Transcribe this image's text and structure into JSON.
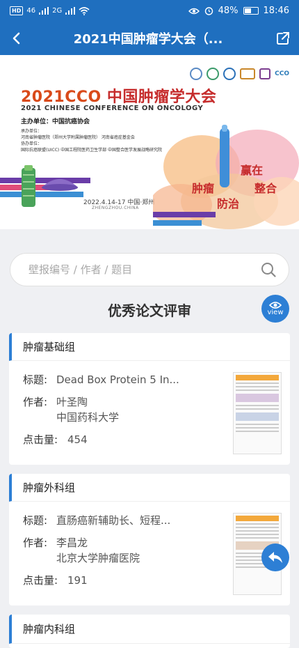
{
  "status_bar": {
    "network_badge": "HD",
    "signal_1": "46",
    "signal_2": "2G",
    "battery": "48%",
    "time": "18:46"
  },
  "nav": {
    "title": "2021中国肿瘤学大会（...",
    "back_icon": "back-arrow",
    "share_icon": "share"
  },
  "banner": {
    "title_year": "2021CCO",
    "title_cn": " 中国肿瘤学大会",
    "title_en": "2021 CHINESE CONFERENCE ON ONCOLOGY",
    "host": "主办单位：中国抗癌协会",
    "organizer_label": "承办单位：",
    "organizer_text": "河南省肿瘤医院（郑州大学附属肿瘤医院） 河南省癌症基金会",
    "co_label": "协办单位：",
    "co_text": "国际抗癌联盟(UICC) 中国工程院医药卫生学部  中国整合医学发展战略研究院",
    "date": "2022.4.14-17  中国·郑州",
    "city_en": "ZHENGZHOU.CHINA",
    "logo_text": "CCO",
    "slogan_1": "赢在",
    "slogan_2": "肿瘤",
    "slogan_3": "整合",
    "slogan_4": "防治"
  },
  "search": {
    "placeholder": "壁报编号 / 作者 / 题目"
  },
  "section": {
    "title": "优秀论文评审",
    "view_label": "view"
  },
  "cards": [
    {
      "category": "肿瘤基础组",
      "title_key": "标题:",
      "title": "Dead Box Protein 5 In...",
      "author_key": "作者:",
      "author": "叶圣陶",
      "institution": "中国药科大学",
      "clicks_key": "点击量:",
      "clicks": "454"
    },
    {
      "category": "肿瘤外科组",
      "title_key": "标题:",
      "title": "直肠癌新辅助长、短程...",
      "author_key": "作者:",
      "author": "李昌龙",
      "institution": "北京大学肿瘤医院",
      "clicks_key": "点击量:",
      "clicks": "191"
    },
    {
      "category": "肿瘤内科组"
    }
  ],
  "colors": {
    "primary": "#1f6fbf",
    "accent": "#2d7fd5",
    "background": "#eff0f3"
  }
}
